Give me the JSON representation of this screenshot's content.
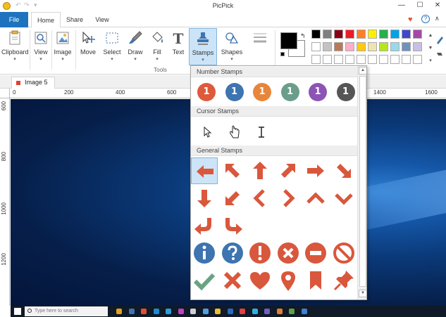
{
  "window": {
    "title": "PicPick",
    "minimize_glyph": "—",
    "maximize_glyph": "☐",
    "close_glyph": "✕",
    "qa_glyphs": [
      "↶",
      "↷",
      "▾"
    ]
  },
  "ribbon_tabs": {
    "file": "File",
    "tabs": [
      "Home",
      "Share",
      "View"
    ],
    "heart_glyph": "♥",
    "help_glyph": "?",
    "collapse_glyph": "∧"
  },
  "ribbon": {
    "buttons": {
      "clipboard": "Clipboard",
      "view": "View",
      "image": "Image",
      "move": "Move",
      "select": "Select",
      "draw": "Draw",
      "fill": "Fill",
      "text": "Text",
      "stamps": "Stamps",
      "shapes": "Shapes"
    },
    "dropdown_glyph": "▾",
    "group_label": "Tools",
    "swap_glyph": "↰",
    "palette_scroll": [
      "▲",
      "▼",
      "▾"
    ]
  },
  "palette_colors": [
    "#000000",
    "#7f7f7f",
    "#880015",
    "#ed1c24",
    "#ff7f27",
    "#fff200",
    "#22b14c",
    "#00a2e8",
    "#3f48cc",
    "#a349a4",
    "#ffffff",
    "#c3c3c3",
    "#b97a57",
    "#ffaec9",
    "#ffc90e",
    "#efe4b0",
    "#b5e61d",
    "#99d9ea",
    "#7092be",
    "#c8bfe7",
    "#ffffff",
    "#ffffff",
    "#ffffff",
    "#ffffff",
    "#ffffff",
    "#ffffff",
    "#ffffff",
    "#ffffff",
    "#ffffff",
    "#ffffff"
  ],
  "document": {
    "tab_label": "Image 5",
    "close_glyph": "×"
  },
  "rulers": {
    "h_labels": [
      "0",
      "200",
      "400",
      "600",
      "1400",
      "1600"
    ],
    "v_labels": [
      "600",
      "800",
      "1000",
      "1200"
    ]
  },
  "taskbar": {
    "search_placeholder": "Type here to search"
  },
  "stamps_panel": {
    "sections": {
      "number": "Number Stamps",
      "cursor": "Cursor Stamps",
      "general": "General Stamps"
    },
    "number_stamps": [
      {
        "label": "1",
        "color": "#dd5a3c"
      },
      {
        "label": "1",
        "color": "#3e74b0"
      },
      {
        "label": "1",
        "color": "#e7863a"
      },
      {
        "label": "1",
        "color": "#6a9e8a"
      },
      {
        "label": "1",
        "color": "#8b54b5"
      },
      {
        "label": "1",
        "color": "#555555"
      }
    ],
    "cursor_stamps": [
      "arrow-cursor",
      "hand-cursor",
      "ibeam-cursor"
    ],
    "stamp_color": "#d9573c",
    "selected_color": "#cce4f7"
  }
}
